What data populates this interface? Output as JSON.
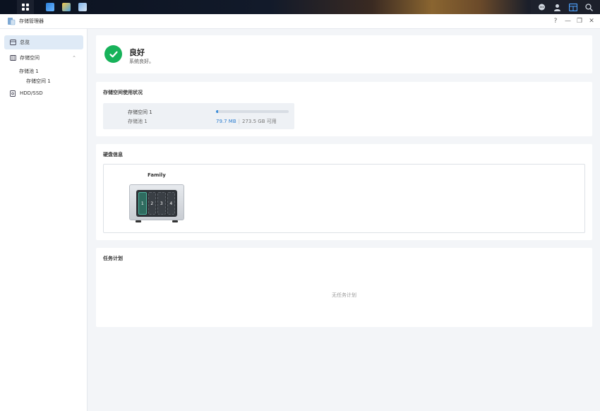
{
  "window": {
    "title": "存储管理器"
  },
  "window_controls": {
    "help": "?",
    "minimize": "—",
    "restore": "❐",
    "close": "✕"
  },
  "sidebar": {
    "overview": "总览",
    "storage": "存储空间",
    "pool": "存储池 1",
    "volume": "存储空间 1",
    "hdd": "HDD/SSD"
  },
  "status": {
    "title": "良好",
    "subtitle": "系统良好。"
  },
  "usage": {
    "section_title": "存储空间使用状况",
    "volume_name": "存储空间 1",
    "pool_name": "存储池 1",
    "used": "79.7 MB",
    "separator": "|",
    "available": "273.5 GB 可用",
    "fill_percent": 0.03
  },
  "disk": {
    "section_title": "硬盘信息",
    "nas_name": "Family",
    "bays": [
      "1",
      "2",
      "3",
      "4"
    ]
  },
  "tasks": {
    "section_title": "任务计划",
    "empty": "无任务计划"
  },
  "colors": {
    "accent": "#3f8ed9",
    "ok": "#17b25a",
    "active_nav": "#dfeaf6"
  }
}
